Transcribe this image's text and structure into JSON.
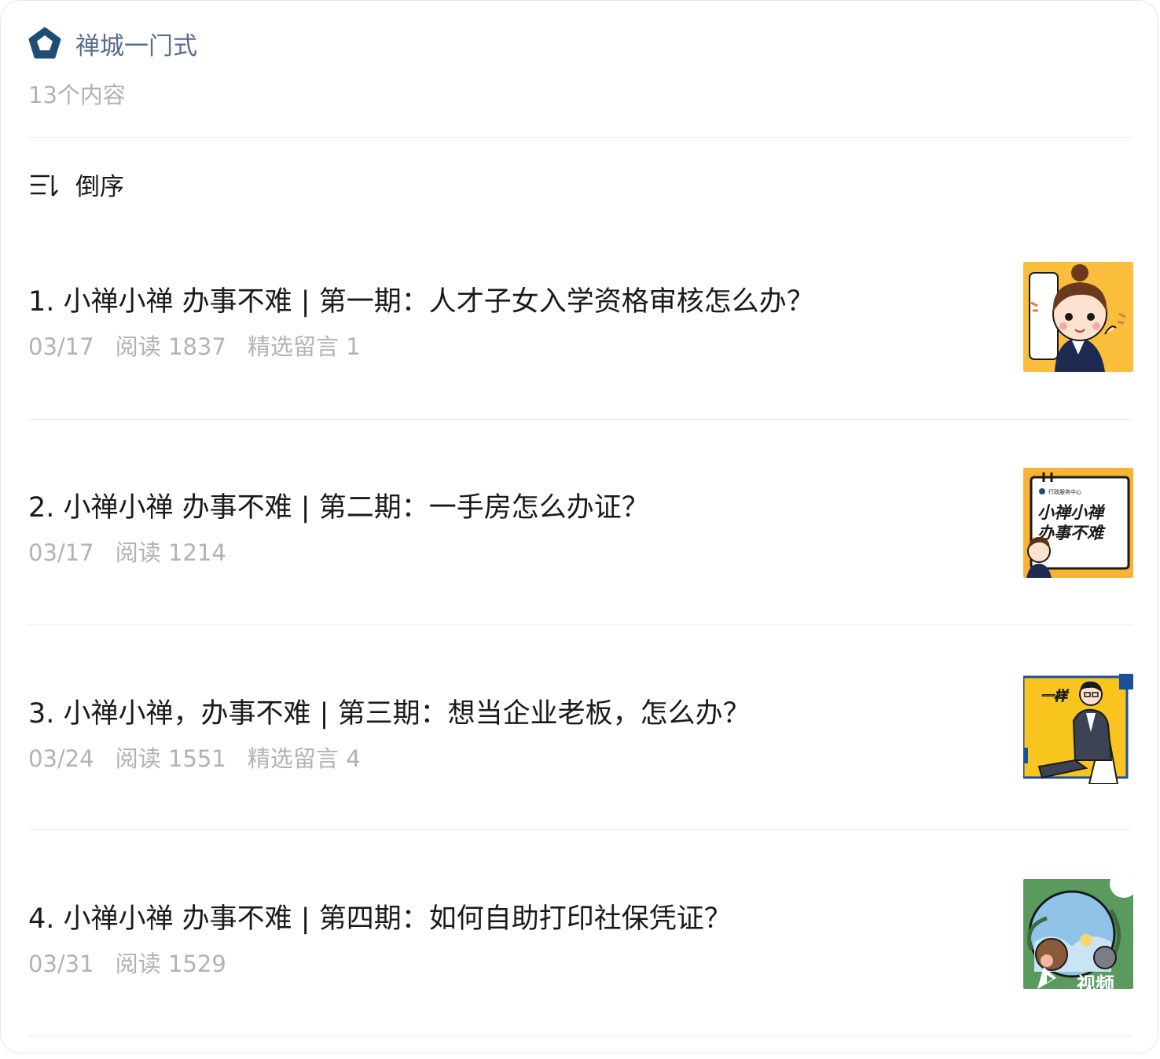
{
  "account": {
    "name": "禅城一门式",
    "logo_icon": "pentagon-logo-icon",
    "brand_color": "#1e4e78"
  },
  "content_count": "13个内容",
  "sort": {
    "icon": "sort-order-icon",
    "label": "倒序"
  },
  "articles": [
    {
      "title": "1. 小禅小禅 办事不难 | 第一期：人才子女入学资格审核怎么办？",
      "date": "03/17",
      "reads": "阅读 1837",
      "comments": "精选留言 1"
    },
    {
      "title": "2. 小禅小禅 办事不难 | 第二期：一手房怎么办证？",
      "date": "03/17",
      "reads": "阅读 1214",
      "comments": "",
      "thumb_text": {
        "org": "行政服务中心",
        "line1": "小禅小禅",
        "line2": "办事不难"
      }
    },
    {
      "title": "3. 小禅小禅，办事不难 | 第三期：想当企业老板，怎么办？",
      "date": "03/24",
      "reads": "阅读 1551",
      "comments": "精选留言 4",
      "thumb_text": {
        "word": "一样"
      }
    },
    {
      "title": "4. 小禅小禅 办事不难 | 第四期：如何自助打印社保凭证？",
      "date": "03/31",
      "reads": "阅读 1529",
      "comments": "",
      "thumb_text": {
        "badge": "视频"
      }
    }
  ]
}
